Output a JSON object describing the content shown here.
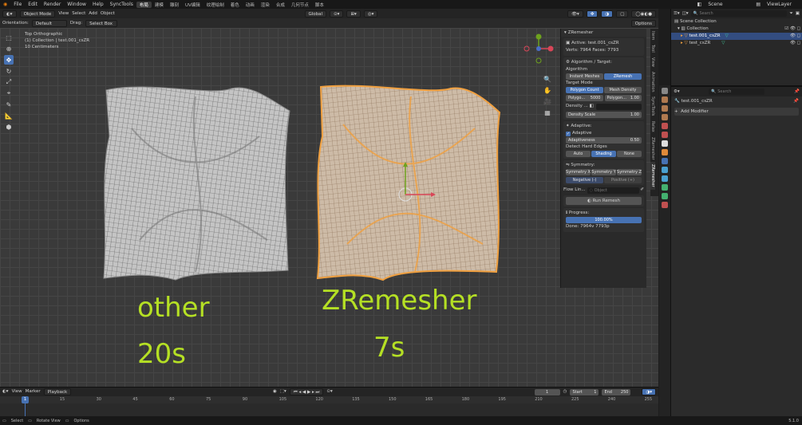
{
  "menu": {
    "items": [
      "File",
      "Edit",
      "Render",
      "Window",
      "Help",
      "SyncTools"
    ],
    "workspaces": [
      "布局",
      "建模",
      "雕刻",
      "UV编辑",
      "纹理绘制",
      "着色",
      "动画",
      "渲染",
      "合成",
      "几何节点",
      "脚本"
    ],
    "active_workspace": "布局",
    "scene": "Scene",
    "view_layer": "ViewLayer"
  },
  "viewport_header": {
    "mode": "Object Mode",
    "menus": [
      "View",
      "Select",
      "Add",
      "Object"
    ],
    "transform": "Global",
    "orientation_label": "Orientation:",
    "orientation_value": "Default",
    "drag_label": "Drag:",
    "drag_value": "Select Box",
    "options": "Options"
  },
  "viewport_info": {
    "view": "Top Orthographic",
    "collection": "(1) Collection | test.001_csZR",
    "scale": "10 Centimeters"
  },
  "annotations": {
    "left_line1": "other",
    "left_line2": "20s",
    "right_line1": "ZRemesher",
    "right_line2": "7s"
  },
  "zremesher": {
    "header": "ZRemesher",
    "active": "Active: test.001_csZR",
    "verts": "Verts: 7964  Faces: 7793",
    "algo_section": "Algorithm / Target:",
    "algorithm_label": "Algorithm",
    "algo_options": [
      "Instant Meshes",
      "ZRemesh"
    ],
    "algo_selected": 1,
    "target_mode_label": "Target Mode",
    "target_options": [
      "Polygon Count",
      "Mesh Density"
    ],
    "target_selected": 0,
    "polygon_label": "Polygo...",
    "polygon_value": "5000",
    "polygon2_label": "Polygon...",
    "polygon2_value": "1.00",
    "density_label": "Density ...",
    "density_scale_label": "Density Scale",
    "density_scale_value": "1.00",
    "adaptive_section": "Adaptive:",
    "adaptive_check": "Adaptive",
    "adaptiveness_label": "Adaptiveness",
    "adaptiveness_value": "0.50",
    "hard_edges_label": "Detect Hard Edges",
    "hard_edge_options": [
      "Auto",
      "Shading",
      "None"
    ],
    "hard_edge_selected": 1,
    "symmetry_section": "Symmetry:",
    "symmetry_options": [
      "Symmetry X",
      "Symmetry Y",
      "Symmetry Z"
    ],
    "negative": "Negative (-)",
    "positive": "Positive (+)",
    "flow_label": "Flow Lin...",
    "flow_placeholder": "Object",
    "run": "Run Remesh",
    "progress_label": "Progress:",
    "progress_value": 1.0,
    "progress_text": "100.00%",
    "done": "Done: 7964v 7793p"
  },
  "vtabs": [
    "Item",
    "Tool",
    "View",
    "Animation",
    "SyncTools",
    "Relax",
    "ZRemesher",
    "ZRemesher"
  ],
  "outliner": {
    "root": "Scene Collection",
    "collection": "Collection",
    "objects": [
      "test.001_csZR",
      "test_csZR"
    ],
    "search_placeholder": "Search"
  },
  "properties": {
    "search_placeholder": "Search",
    "object_name": "test.001_csZR",
    "add_modifier": "Add Modifier"
  },
  "timeline": {
    "menus": [
      "View",
      "Marker",
      "Playback"
    ],
    "current_frame": "1",
    "start_label": "Start",
    "start": "1",
    "end_label": "End",
    "end": "250",
    "ticks": [
      "1",
      "15",
      "30",
      "45",
      "60",
      "75",
      "90",
      "105",
      "120",
      "135",
      "150",
      "165",
      "180",
      "195",
      "210",
      "225",
      "240",
      "255"
    ]
  },
  "status": {
    "items": [
      "Select",
      "Rotate View",
      "Options"
    ],
    "version": "5.1.0"
  },
  "colors": {
    "accent": "#4772b3",
    "annotation": "#b5e024",
    "selection": "#f0a040"
  }
}
